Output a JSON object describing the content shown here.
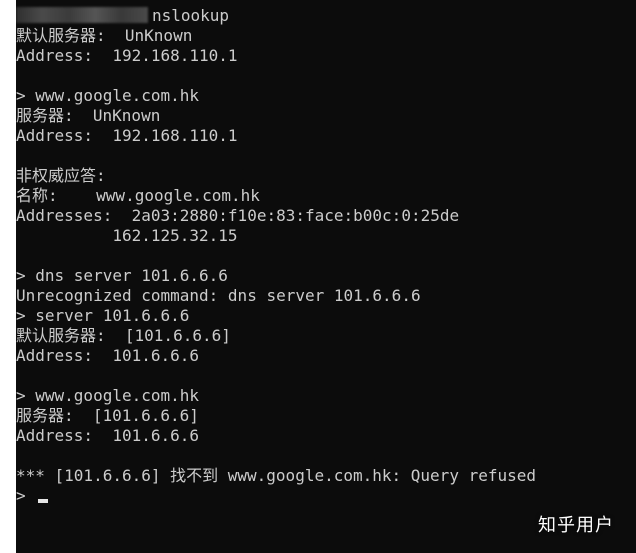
{
  "terminal": {
    "lines": [
      "nslookup",
      "默认服务器:  UnKnown",
      "Address:  192.168.110.1",
      "",
      "> www.google.com.hk",
      "服务器:  UnKnown",
      "Address:  192.168.110.1",
      "",
      "非权威应答:",
      "名称:    www.google.com.hk",
      "Addresses:  2a03:2880:f10e:83:face:b00c:0:25de",
      "          162.125.32.15",
      "",
      "> dns server 101.6.6.6",
      "Unrecognized command: dns server 101.6.6.6",
      "> server 101.6.6.6",
      "默认服务器:  [101.6.6.6]",
      "Address:  101.6.6.6",
      "",
      "> www.google.com.hk",
      "服务器:  [101.6.6.6]",
      "Address:  101.6.6.6",
      "",
      "*** [101.6.6.6] 找不到 www.google.com.hk: Query refused",
      ">"
    ]
  },
  "watermark": {
    "text": "知乎用户"
  },
  "colors": {
    "background": "#0c0c0c",
    "foreground": "#cccccc"
  }
}
